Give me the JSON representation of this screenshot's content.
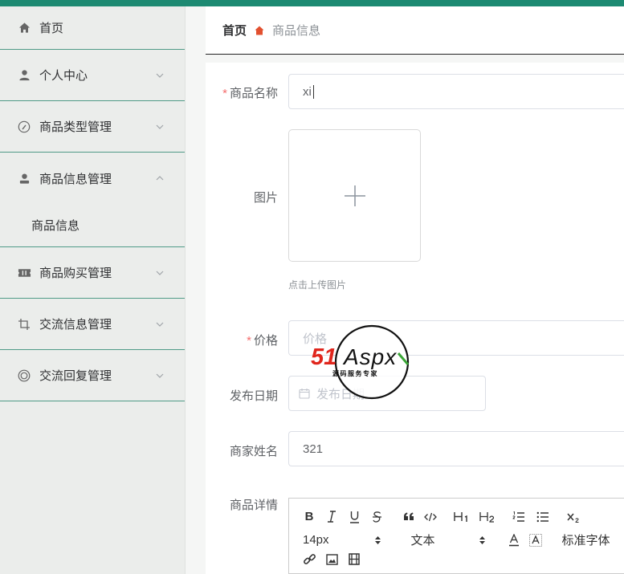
{
  "sidebar": {
    "items": [
      {
        "label": "首页",
        "icon": "home-icon"
      },
      {
        "label": "个人中心",
        "icon": "user-icon"
      },
      {
        "label": "商品类型管理",
        "icon": "category-icon"
      },
      {
        "label": "商品信息管理",
        "icon": "goods-icon",
        "sub": "商品信息"
      },
      {
        "label": "商品购买管理",
        "icon": "ticket-icon"
      },
      {
        "label": "交流信息管理",
        "icon": "crop-icon"
      },
      {
        "label": "交流回复管理",
        "icon": "reply-icon"
      }
    ]
  },
  "breadcrumb": {
    "home": "首页",
    "current": "商品信息"
  },
  "form": {
    "name": {
      "label": "商品名称",
      "value": "xi"
    },
    "image": {
      "label": "图片",
      "hint": "点击上传图片"
    },
    "price": {
      "label": "价格",
      "placeholder": "价格"
    },
    "date": {
      "label": "发布日期",
      "placeholder": "发布日期"
    },
    "merchant": {
      "label": "商家姓名",
      "value": "321"
    },
    "detail": {
      "label": "商品详情"
    }
  },
  "editor": {
    "size": "14px",
    "paragraph": "文本",
    "font": "标准字体"
  },
  "watermark": {
    "brand": "51Aspx",
    "tagline": "源码服务专家"
  },
  "colors": {
    "topbar": "#1d8a72",
    "divider": "#4f9a87",
    "required": "#f56c6c"
  }
}
